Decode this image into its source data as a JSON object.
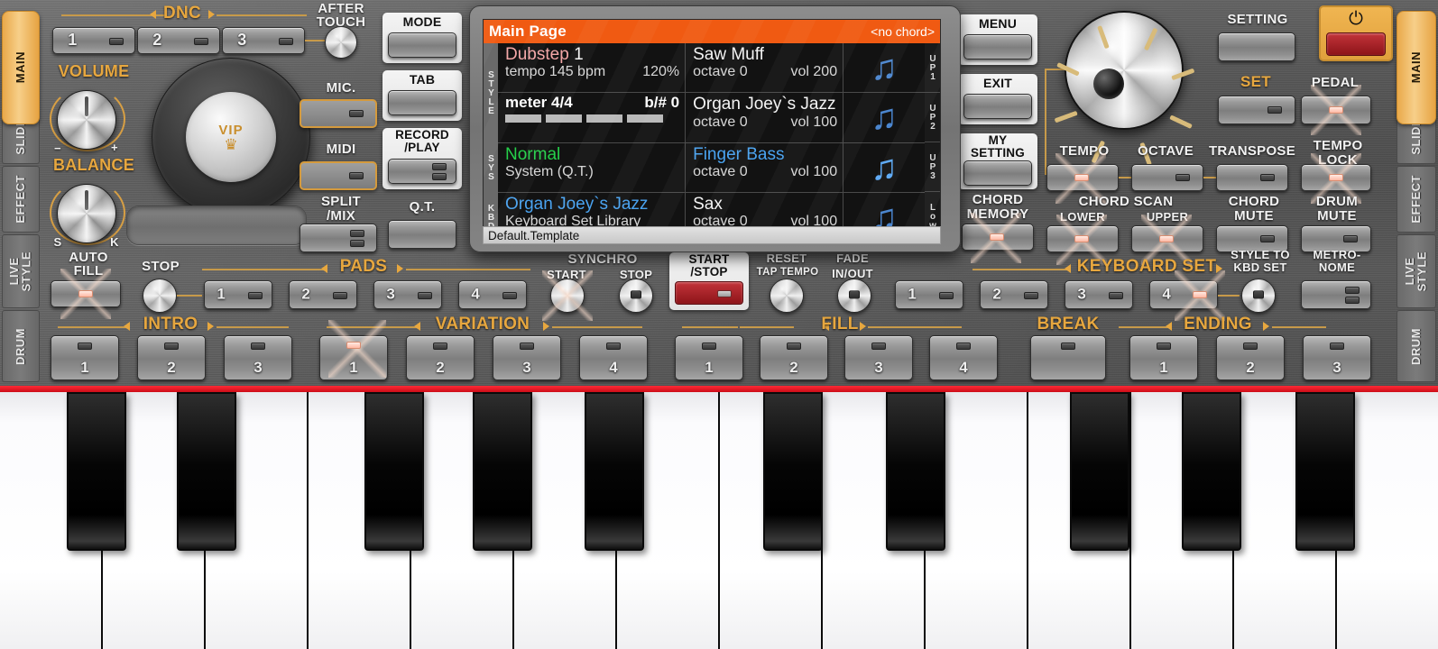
{
  "sidebar": {
    "items": [
      {
        "label": "MAIN",
        "active": true
      },
      {
        "label": "SLIDER",
        "active": false
      },
      {
        "label": "EFFECT",
        "active": false
      },
      {
        "label": "LIVE\nSTYLE",
        "active": false
      },
      {
        "label": "DRUM",
        "active": false
      }
    ]
  },
  "groups": {
    "dnc": "DNC",
    "pads": "PADS",
    "keyboard_set": "KEYBOARD SET",
    "intro": "INTRO",
    "variation": "VARIATION",
    "fill": "FILL",
    "break": "BREAK",
    "ending": "ENDING"
  },
  "dnc": {
    "buttons": [
      "1",
      "2",
      "3"
    ],
    "after_touch": "AFTER\nTOUCH"
  },
  "knobs": {
    "volume": "VOLUME",
    "volume_min": "−",
    "volume_max": "+",
    "balance": "BALANCE",
    "balance_left": "S",
    "balance_right": "K",
    "auto_fill": "AUTO\nFILL",
    "vip": "VIP"
  },
  "right_column_buttons": {
    "mic": "MIC.",
    "midi": "MIDI",
    "split_mix": "SPLIT\n/MIX"
  },
  "center_buttons": {
    "mode": "MODE",
    "tab": "TAB",
    "record_play": "RECORD\n/PLAY",
    "qt": "Q.T."
  },
  "lcd": {
    "title": "Main Page",
    "chord": "<no chord>",
    "footer": "Default.Template",
    "left_labels": [
      "STYLE",
      "SYS",
      "KBD"
    ],
    "right_labels": [
      "UP1",
      "UP2",
      "UP3",
      "Low"
    ],
    "style": {
      "name": "Dubstep",
      "variation": "1",
      "tempo_label": "tempo 145 bpm",
      "tempo_percent": "120%",
      "meter_label": "meter 4/4",
      "key_label": "b/#",
      "key_value": "0"
    },
    "sys": {
      "name": "Normal",
      "sub": "System (Q.T.)"
    },
    "kbd": {
      "name": "Organ Joey`s Jazz",
      "sub": "Keyboard Set Library"
    },
    "parts": [
      {
        "name": "Saw Muff",
        "octave_label": "octave",
        "octave": "0",
        "vol_label": "vol",
        "vol": "200",
        "slot": "UP1"
      },
      {
        "name": "Organ Joey`s Jazz",
        "octave_label": "octave",
        "octave": "0",
        "vol_label": "vol",
        "vol": "100",
        "slot": "UP2"
      },
      {
        "name": "Finger Bass",
        "octave_label": "octave",
        "octave": "0",
        "vol_label": "vol",
        "vol": "100",
        "slot": "UP3"
      },
      {
        "name": "Sax",
        "octave_label": "octave",
        "octave": "0",
        "vol_label": "vol",
        "vol": "100",
        "slot": "Low"
      }
    ]
  },
  "menu_column": {
    "menu": "MENU",
    "exit": "EXIT",
    "my_setting": "MY\nSETTING",
    "chord_memory": "CHORD\nMEMORY"
  },
  "right_panel": {
    "tempo": "TEMPO",
    "octave": "OCTAVE",
    "transpose": "TRANSPOSE",
    "tempo_lock": "TEMPO\nLOCK",
    "chord_scan": "CHORD SCAN",
    "chord_scan_lower": "LOWER",
    "chord_scan_upper": "UPPER",
    "chord_mute": "CHORD\nMUTE",
    "drum_mute": "DRUM\nMUTE",
    "setting": "SETTING",
    "set": "SET",
    "pedal": "PEDAL",
    "power": "⏻"
  },
  "transport": {
    "stop": "STOP",
    "synchro": "SYNCHRO",
    "synchro_start": "START",
    "synchro_stop": "STOP",
    "start_stop": "START\n/STOP",
    "reset": "RESET",
    "tap_tempo": "TAP TEMPO",
    "fade": "FADE",
    "fade_inout": "IN/OUT",
    "style_to_kbd_set": "STYLE TO\nKBD SET",
    "metronome": "METRO-\nNOME"
  },
  "pads": [
    "1",
    "2",
    "3",
    "4"
  ],
  "keyboard_set_buttons": [
    "1",
    "2",
    "3",
    "4"
  ],
  "intro_buttons": [
    "1",
    "2",
    "3"
  ],
  "variation_buttons": [
    "1",
    "2",
    "3",
    "4"
  ],
  "fill_buttons": [
    "1",
    "2",
    "3",
    "4"
  ],
  "ending_buttons": [
    "1",
    "2",
    "3"
  ],
  "colors": {
    "accent_gold": "#e7a73f",
    "lcd_title_bg": "#f05a12",
    "active_tab": "#eead4c",
    "power_red": "#a51d22",
    "keyboard_red": "#ff2a36"
  }
}
